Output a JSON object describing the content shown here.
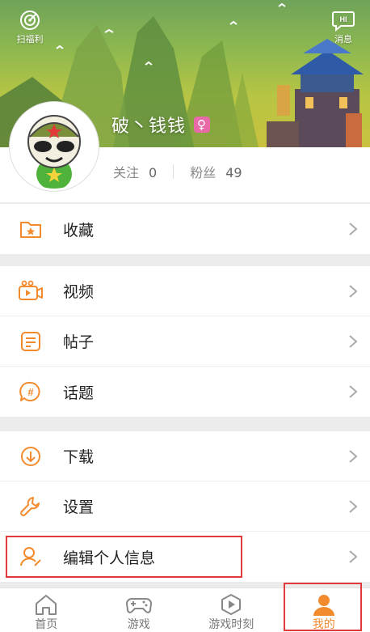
{
  "header": {
    "scan_label": "扫福利",
    "message_label": "消息",
    "message_badge": "HI",
    "username": "破丶钱钱",
    "gender_symbol": "♀"
  },
  "profile": {
    "following_label": "关注",
    "following_count": "0",
    "fans_label": "粉丝",
    "fans_count": "49"
  },
  "menu": {
    "favorites": "收藏",
    "videos": "视频",
    "posts": "帖子",
    "topics": "话题",
    "downloads": "下载",
    "settings": "设置",
    "edit_profile": "编辑个人信息"
  },
  "tabs": [
    {
      "label": "首页"
    },
    {
      "label": "游戏"
    },
    {
      "label": "游戏时刻"
    },
    {
      "label": "我的"
    }
  ],
  "colors": {
    "accent": "#f28a2e",
    "highlight_border": "#e23a3a",
    "gender_badge": "#e86aa6"
  }
}
